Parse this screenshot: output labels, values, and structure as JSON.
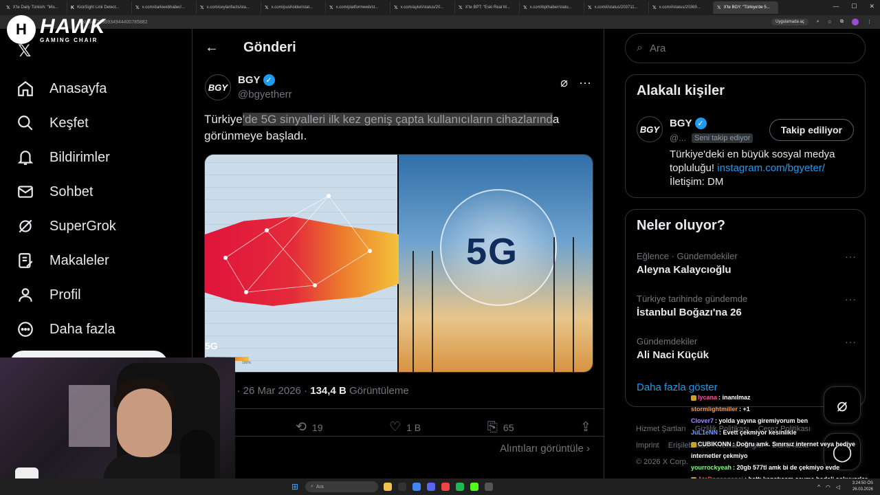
{
  "browser": {
    "tabs": [
      {
        "fav": "𝕏",
        "title": "X'te Daily Türkish: \"Mis..."
      },
      {
        "fav": "K",
        "title": "KickSight Link Detect..."
      },
      {
        "fav": "𝕏",
        "title": "x.com/darkwebhaber/..."
      },
      {
        "fav": "𝕏",
        "title": "x.com/ceylanfacts/sta..."
      },
      {
        "fav": "𝕏",
        "title": "x.com/pusholder/stat..."
      },
      {
        "fav": "𝕏",
        "title": "x.com/platformweb/st..."
      },
      {
        "fav": "𝕏",
        "title": "x.com/aykiri/status/20..."
      },
      {
        "fav": "𝕏",
        "title": "X'te BPT: \"Eski Real M..."
      },
      {
        "fav": "𝕏",
        "title": "x.com/bpthaber/statu..."
      },
      {
        "fav": "𝕏",
        "title": "x.com/i/status/203711..."
      },
      {
        "fav": "𝕏",
        "title": "x.com/i/status/20369..."
      },
      {
        "fav": "𝕏",
        "title": "X'te BGY: \"Türkiye'de 5..."
      }
    ],
    "url": "status/2036934944400785882",
    "app_button": "Uygulamada aç"
  },
  "overlay": {
    "brand_name": "HAWK",
    "brand_sub": "GAMING CHAIR",
    "brand_initial": "H"
  },
  "nav": {
    "logo": "𝕏",
    "items": [
      {
        "label": "Anasayfa",
        "icon": "home-icon"
      },
      {
        "label": "Keşfet",
        "icon": "search-icon"
      },
      {
        "label": "Bildirimler",
        "icon": "bell-icon"
      },
      {
        "label": "Sohbet",
        "icon": "mail-icon"
      },
      {
        "label": "SuperGrok",
        "icon": "grok-icon"
      },
      {
        "label": "Makaleler",
        "icon": "article-icon"
      },
      {
        "label": "Profil",
        "icon": "person-icon"
      },
      {
        "label": "Daha fazla",
        "icon": "more-circle-icon"
      }
    ]
  },
  "post": {
    "header_title": "Gönderi",
    "author_name": "BGY",
    "author_handle": "@bgyetherr",
    "avatar_text": "BGY",
    "text_pre": "Türkiye",
    "text_highlight": "'de 5G sinyalleri ilk kez geniş çapta kullanıcıların cihazlarınd",
    "text_post": "a görünmeye başladı.",
    "media_left_label": "5G",
    "media_left_scale": "100%",
    "media_right_label": "5G",
    "time": "5 · 26 Mar 2026 · ",
    "views": "134,4 B",
    "views_label": " Görüntüleme",
    "stats": {
      "reposts": "19",
      "likes": "1 B",
      "bookmarks": "65"
    },
    "quotes_label": "Alıntıları görüntüle"
  },
  "right": {
    "search_placeholder": "Ara",
    "related": {
      "title": "Alakalı kişiler",
      "name": "BGY",
      "handle": "@...",
      "follows_you": "Seni takip ediyor",
      "follow_button": "Takip ediliyor",
      "bio_line1": "Türkiye'deki en büyük sosyal medya topluluğu! ",
      "bio_link": "instagram.com/bgyeter/",
      "bio_line2": "İletişim: DM"
    },
    "trends": {
      "title": "Neler oluyor?",
      "items": [
        {
          "category": "Eğlence · Gündemdekiler",
          "title": "Aleyna Kalaycıoğlu"
        },
        {
          "category": "Türkiye tarihinde gündemde",
          "title": "İstanbul Boğazı'na 26"
        },
        {
          "category": "Gündemdekiler",
          "title": "Ali Naci Küçük"
        }
      ],
      "show_more": "Daha fazla göster"
    },
    "footer": [
      "Hizmet Şartları",
      "Gizlilik Politikası",
      "Çerez Politikası",
      "Imprint",
      "Erişilebilirlik",
      "Reklam bilgisi",
      "Daha fazla",
      "© 2026 X Corp."
    ]
  },
  "chat": [
    {
      "user": "lycana",
      "color": "#ff4fa3",
      "text": ": inanılmaz",
      "badge": true
    },
    {
      "user": "stormlightmiller",
      "color": "#ff9a4a",
      "text": ": +1",
      "badge": false
    },
    {
      "user": "Clover7",
      "color": "#a98bff",
      "text": ": yolda yayına giremiyorum ben",
      "badge": false
    },
    {
      "user": "JuL1eNN",
      "color": "#7a9bff",
      "text": ": Evett çekmiyor kesinlikle",
      "badge": false
    },
    {
      "user": "CUBIKONN",
      "color": "#ffffff",
      "text": ": Doğru amk. Sınırsız internet veya hediye internetler çekmiyo",
      "badge": true
    },
    {
      "user": "yourrockyeah",
      "color": "#7dff7a",
      "text": ": 20gb 577tl amk bi de çekmiyo evde",
      "badge": false
    },
    {
      "user": "AtaDogangenci",
      "color": "#ff4a4a",
      "text": ": hattı kapatıcam çayma bedeli sokuyorlar mecbur sikiliyoruz",
      "badge": true
    }
  ],
  "taskbar": {
    "search_placeholder": "Ara",
    "time": "3:24:50 ÖS",
    "date": "26.03.2026"
  }
}
